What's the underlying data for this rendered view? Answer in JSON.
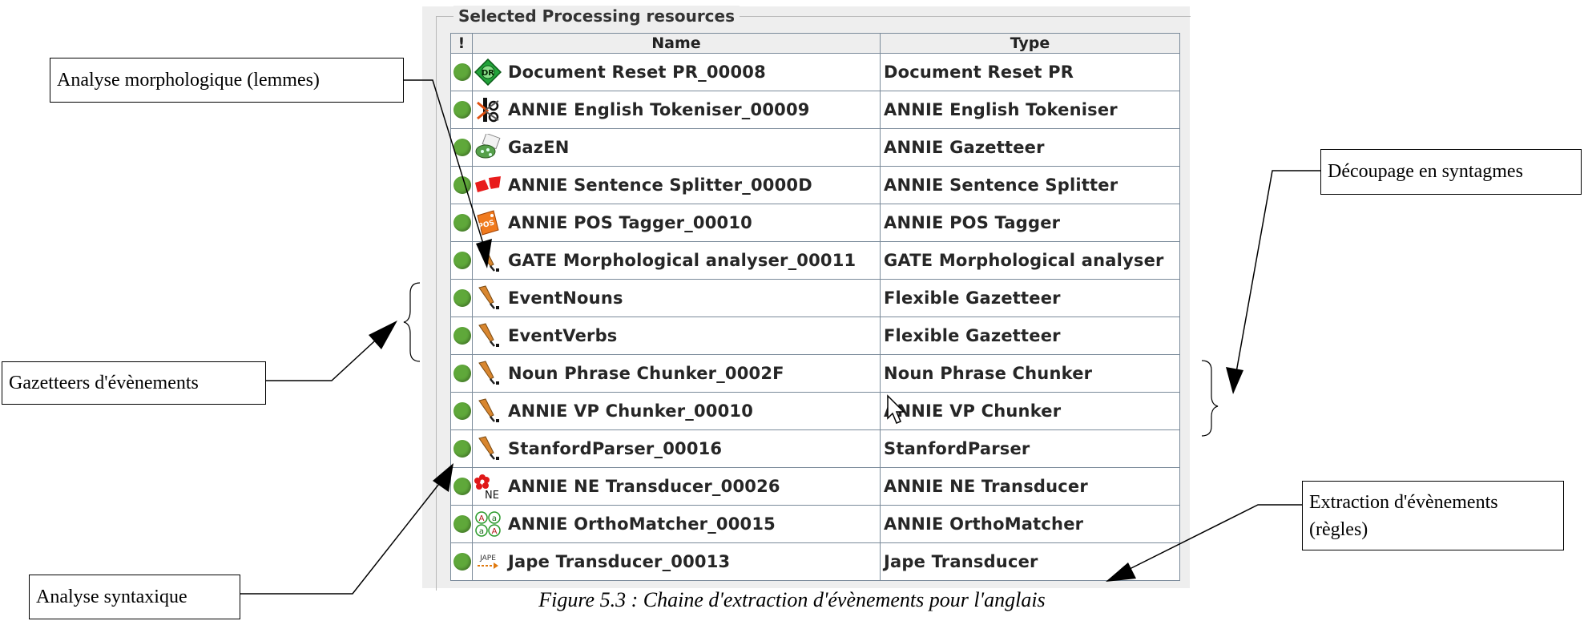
{
  "panel": {
    "title": "Selected Processing resources",
    "columns": {
      "status": "!",
      "name": "Name",
      "type": "Type"
    },
    "rows": [
      {
        "name": "Document Reset PR_00008",
        "type": "Document Reset PR",
        "icon": "document-reset-icon"
      },
      {
        "name": "ANNIE English Tokeniser_00009",
        "type": "ANNIE English Tokeniser",
        "icon": "tokeniser-scissors-icon"
      },
      {
        "name": "GazEN",
        "type": "ANNIE Gazetteer",
        "icon": "gazetteer-icon"
      },
      {
        "name": "ANNIE Sentence Splitter_0000D",
        "type": "ANNIE Sentence Splitter",
        "icon": "sentence-splitter-icon"
      },
      {
        "name": "ANNIE POS Tagger_00010",
        "type": "ANNIE POS Tagger",
        "icon": "pos-tagger-icon"
      },
      {
        "name": "GATE Morphological analyser_00011",
        "type": "GATE Morphological analyser",
        "icon": "plugin-pin-icon"
      },
      {
        "name": "EventNouns",
        "type": "Flexible Gazetteer",
        "icon": "plugin-pin-icon"
      },
      {
        "name": "EventVerbs",
        "type": "Flexible Gazetteer",
        "icon": "plugin-pin-icon"
      },
      {
        "name": "Noun Phrase Chunker_0002F",
        "type": "Noun Phrase Chunker",
        "icon": "plugin-pin-icon"
      },
      {
        "name": "ANNIE VP Chunker_00010",
        "type": "ANNIE VP Chunker",
        "icon": "plugin-pin-icon"
      },
      {
        "name": "StanfordParser_00016",
        "type": "StanfordParser",
        "icon": "plugin-pin-icon"
      },
      {
        "name": "ANNIE NE Transducer_00026",
        "type": "ANNIE NE Transducer",
        "icon": "ne-transducer-icon"
      },
      {
        "name": "ANNIE OrthoMatcher_00015",
        "type": "ANNIE OrthoMatcher",
        "icon": "orthomatcher-icon"
      },
      {
        "name": "Jape Transducer_00013",
        "type": "Jape Transducer",
        "icon": "jape-icon"
      }
    ],
    "status_color": "#5fa83a"
  },
  "annotations": {
    "morpho": "Analyse morphologique (lemmes)",
    "gazetteers": "Gazetteers d'évènements",
    "syntax": "Analyse syntaxique",
    "chunking": "Découpage en syntagmes",
    "extraction_line1": "Extraction d'évènements",
    "extraction_line2": "(règles)"
  },
  "caption": "Figure 5.3 : Chaine d'extraction d'évènements pour l'anglais"
}
